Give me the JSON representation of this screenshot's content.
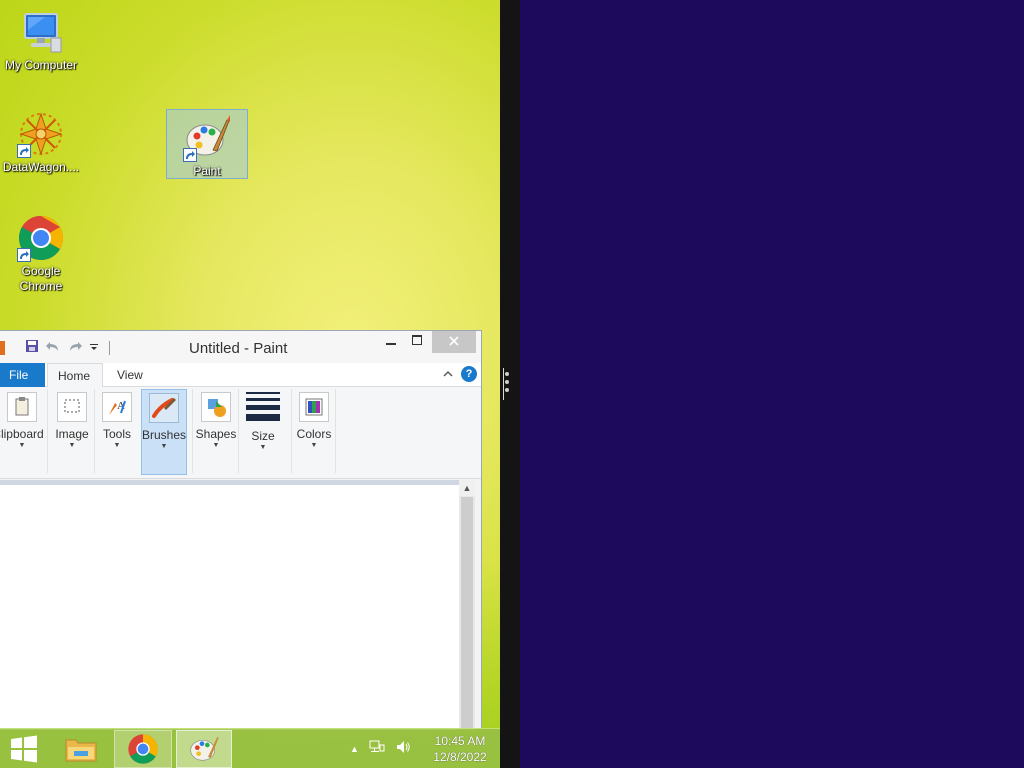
{
  "desktop": {
    "icons": [
      {
        "label": "My Computer",
        "icon": "computer-icon"
      },
      {
        "label": "DataWagon....",
        "icon": "datawagon-icon"
      },
      {
        "label": "Paint",
        "icon": "paint-icon"
      },
      {
        "label": "Google Chrome",
        "label_line1": "Google",
        "label_line2": "Chrome",
        "icon": "chrome-icon"
      }
    ]
  },
  "paint": {
    "title": "Untitled - Paint",
    "window_controls": {
      "minimize": "🗕",
      "maximize": "🗖",
      "close": "✕"
    },
    "tabs": {
      "file": "File",
      "home": "Home",
      "view": "View"
    },
    "help": "?",
    "ribbon": {
      "groups": [
        {
          "label": "Clipboard",
          "icon": "clipboard-icon"
        },
        {
          "label": "Image",
          "icon": "select-icon"
        },
        {
          "label": "Tools",
          "icon": "tools-icon"
        },
        {
          "label": "Brushes",
          "icon": "brush-icon",
          "active": true
        },
        {
          "label": "Shapes",
          "icon": "shapes-icon"
        },
        {
          "label": "Size",
          "icon": "size-icon"
        },
        {
          "label": "Colors",
          "icon": "colors-icon"
        }
      ],
      "dropdown_arrow": "▼"
    },
    "scroll_up": "▲"
  },
  "taskbar": {
    "tray_expand": "▲",
    "time": "10:45 AM",
    "date": "12/8/2022"
  },
  "colors": {
    "desktop_bg": "#d4e034",
    "right_pane_bg": "#1e0a5c",
    "file_tab": "#1979ca"
  }
}
